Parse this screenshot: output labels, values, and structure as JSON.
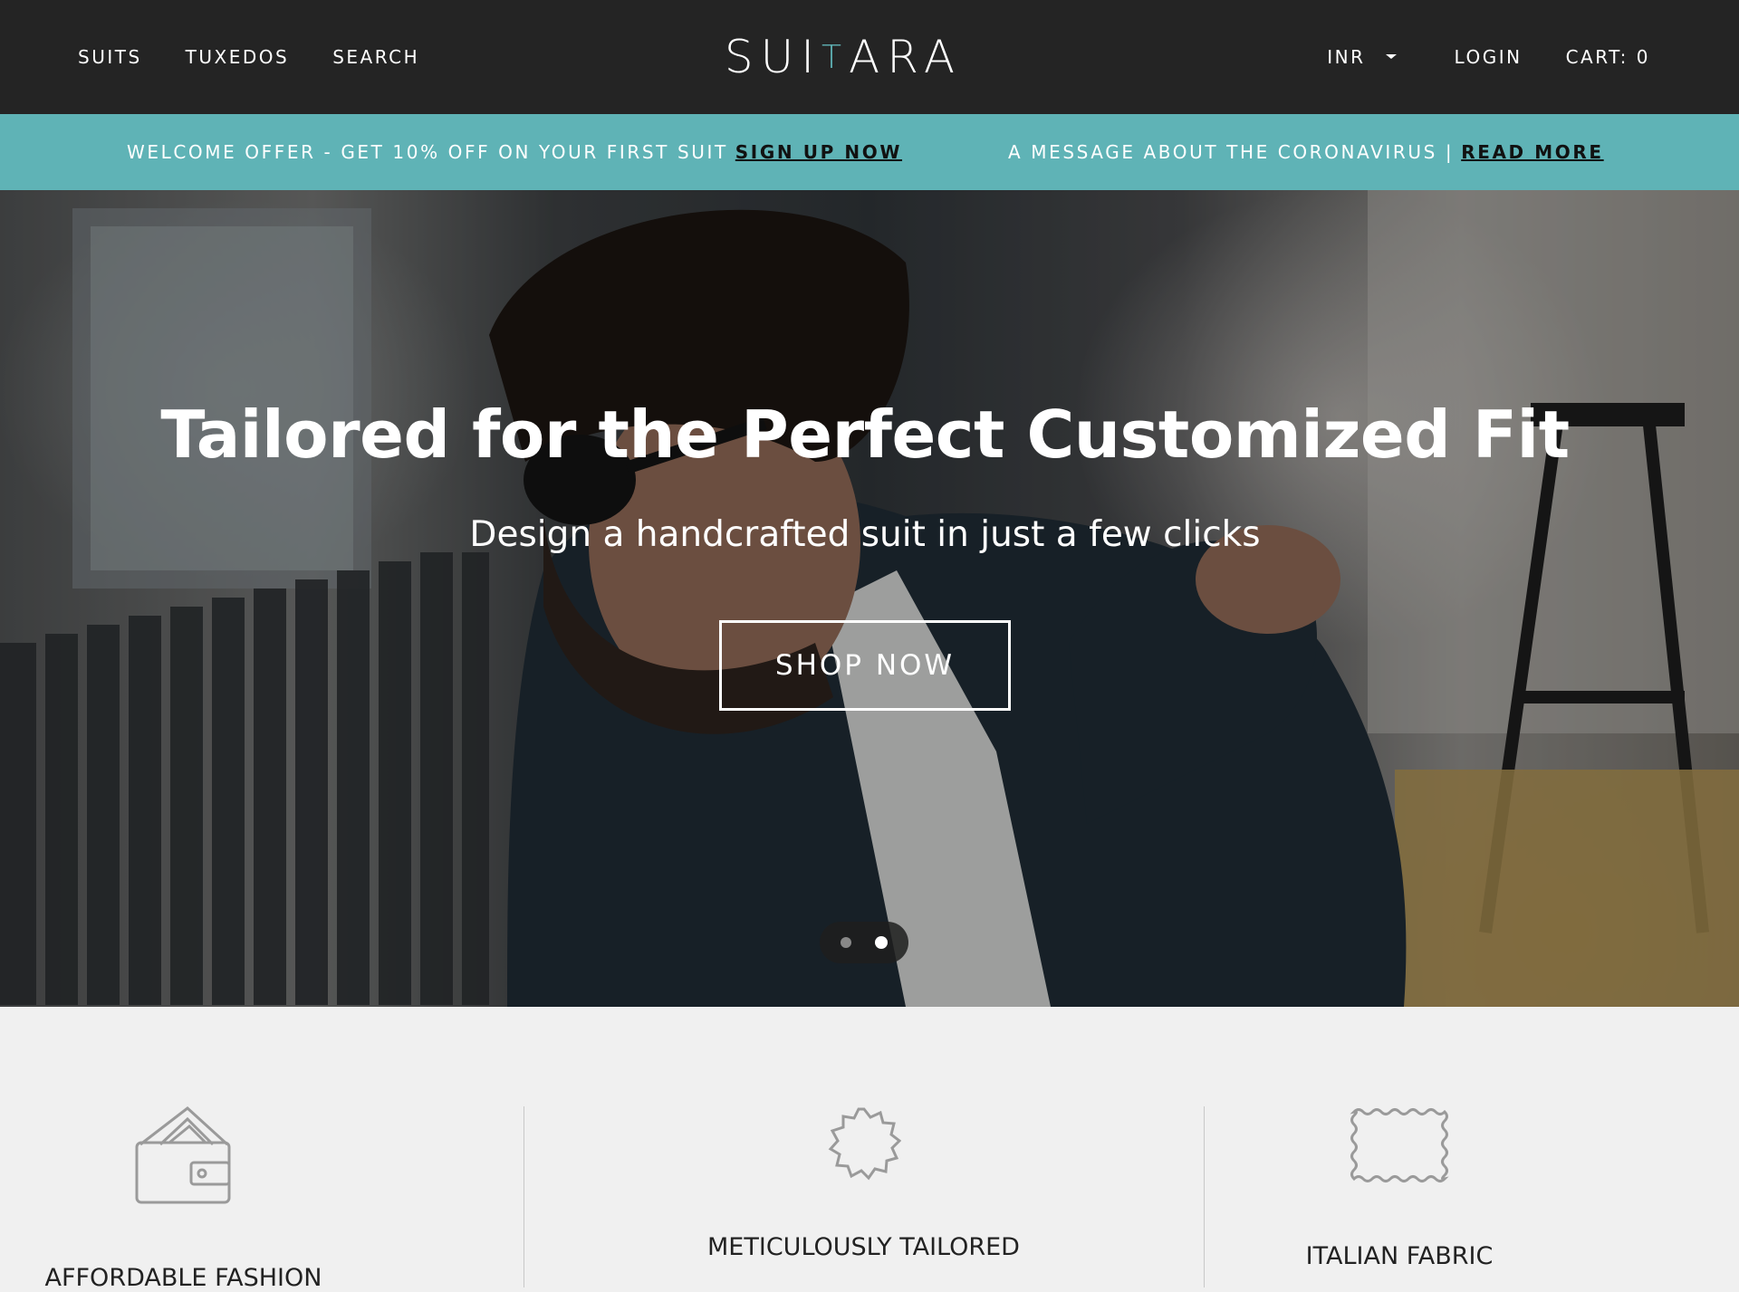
{
  "header": {
    "nav_left": [
      "SUITS",
      "TUXEDOS",
      "SEARCH"
    ],
    "logo": {
      "part1": "SUI",
      "part2": "T",
      "part3": "ARA"
    },
    "currency": "INR",
    "login": "LOGIN",
    "cart": "CART: 0"
  },
  "announcement": {
    "offer_text": "WELCOME OFFER - GET 10% OFF ON YOUR FIRST SUIT",
    "offer_link": "SIGN UP NOW",
    "corona_text": "A MESSAGE ABOUT THE CORONAVIRUS |",
    "corona_link": "READ MORE"
  },
  "hero": {
    "title": "Tailored for the Perfect Customized Fit",
    "subtitle": "Design a handcrafted suit in just a few clicks",
    "cta": "SHOP NOW",
    "slides_total": 2,
    "active_slide": 2
  },
  "features": [
    {
      "label": "AFFORDABLE FASHION",
      "icon": "wallet-icon"
    },
    {
      "label": "METICULOUSLY TAILORED",
      "icon": "badge-icon"
    },
    {
      "label": "ITALIAN FABRIC",
      "icon": "fabric-swatch-icon"
    }
  ],
  "colors": {
    "header_bg": "#242424",
    "accent_teal": "#5fb3b6",
    "features_bg": "#f0f0f0"
  }
}
